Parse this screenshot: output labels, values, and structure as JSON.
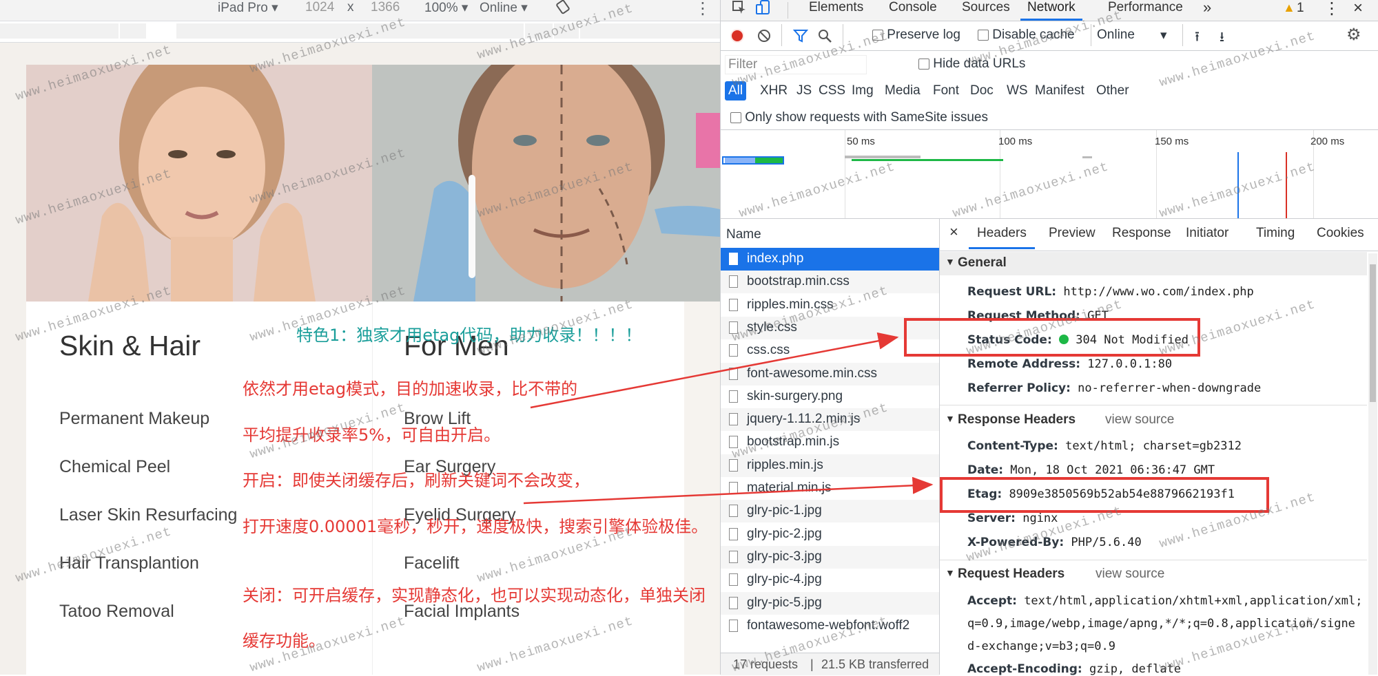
{
  "device_toolbar": {
    "device": "iPad Pro",
    "width": "1024",
    "times": "x",
    "height": "1366",
    "zoom": "100%",
    "network": "Online"
  },
  "site": {
    "col1": {
      "heading": "Skin & Hair",
      "items": [
        "Permanent Makeup",
        "Chemical Peel",
        "Laser Skin Resurfacing",
        "Hair Transplantion",
        "Tatoo Removal"
      ]
    },
    "col2": {
      "heading": "For Men",
      "items": [
        "Brow Lift",
        "Ear Surgery",
        "Eyelid Surgery",
        "Facelift",
        "Facial Implants"
      ]
    }
  },
  "annotations": {
    "teal": "特色1：独家才用etag代码，助力收录！！！！",
    "l1": "依然才用etag模式，目的加速收录，比不带的",
    "l2": "平均提升收录率5%，可自由开启。",
    "l3": "开启：即使关闭缓存后，刷新关键词不会改变，",
    "l4": "打开速度0.00001毫秒，秒开，速度极快，搜索引擎体验极佳。",
    "l5": "关闭：可开启缓存，实现静态化，也可以实现动态化，单独关闭",
    "l6": "缓存功能。"
  },
  "watermark": "www.heimaoxuexi.net",
  "devtools": {
    "tabs": [
      "Elements",
      "Console",
      "Sources",
      "Network",
      "Performance"
    ],
    "more": "»",
    "warning_count": "1",
    "toolbar": {
      "preserve_log": "Preserve log",
      "disable_cache": "Disable cache",
      "throttle": "Online"
    },
    "filter_placeholder": "Filter",
    "hide_data_urls": "Hide data URLs",
    "types": [
      "All",
      "XHR",
      "JS",
      "CSS",
      "Img",
      "Media",
      "Font",
      "Doc",
      "WS",
      "Manifest",
      "Other"
    ],
    "samesite": "Only show requests with SameSite issues",
    "timeline_ticks": [
      "50 ms",
      "100 ms",
      "150 ms",
      "200 ms"
    ],
    "name_header": "Name",
    "files": [
      "index.php",
      "bootstrap.min.css",
      "ripples.min.css",
      "style.css",
      "css.css",
      "font-awesome.min.css",
      "skin-surgery.png",
      "jquery-1.11.2.min.js",
      "bootstrap.min.js",
      "ripples.min.js",
      "material.min.js",
      "glry-pic-1.jpg",
      "glry-pic-2.jpg",
      "glry-pic-3.jpg",
      "glry-pic-4.jpg",
      "glry-pic-5.jpg",
      "fontawesome-webfont.woff2"
    ],
    "footer": {
      "requests": "17 requests",
      "sep": "|",
      "transferred": "21.5 KB transferred"
    },
    "detail_tabs": [
      "Headers",
      "Preview",
      "Response",
      "Initiator",
      "Timing",
      "Cookies"
    ],
    "close": "×",
    "general": {
      "title": "General",
      "request_url_k": "Request URL:",
      "request_url_v": "http://www.wo.com/index.php",
      "method_k": "Request Method:",
      "method_v": "GET",
      "status_k": "Status Code:",
      "status_v": "304 Not Modified",
      "remote_k": "Remote Address:",
      "remote_v": "127.0.0.1:80",
      "referrer_k": "Referrer Policy:",
      "referrer_v": "no-referrer-when-downgrade"
    },
    "response": {
      "title": "Response Headers",
      "view_source": "view source",
      "ctype_k": "Content-Type:",
      "ctype_v": "text/html; charset=gb2312",
      "date_k": "Date:",
      "date_v": "Mon, 18 Oct 2021 06:36:47 GMT",
      "etag_k": "Etag:",
      "etag_v": "8909e3850569b52ab54e8879662193f1",
      "server_k": "Server:",
      "server_v": "nginx",
      "xpb_k": "X-Powered-By:",
      "xpb_v": "PHP/5.6.40"
    },
    "request": {
      "title": "Request Headers",
      "view_source": "view source",
      "accept_k": "Accept:",
      "accept_v1": "text/html,application/xhtml+xml,application/xml;",
      "accept_v2": "q=0.9,image/webp,image/apng,*/*;q=0.8,application/signe",
      "accept_v3": "d-exchange;v=b3;q=0.9",
      "enc_k": "Accept-Encoding:",
      "enc_v": "gzip, deflate"
    },
    "status_color": "#1db846"
  }
}
